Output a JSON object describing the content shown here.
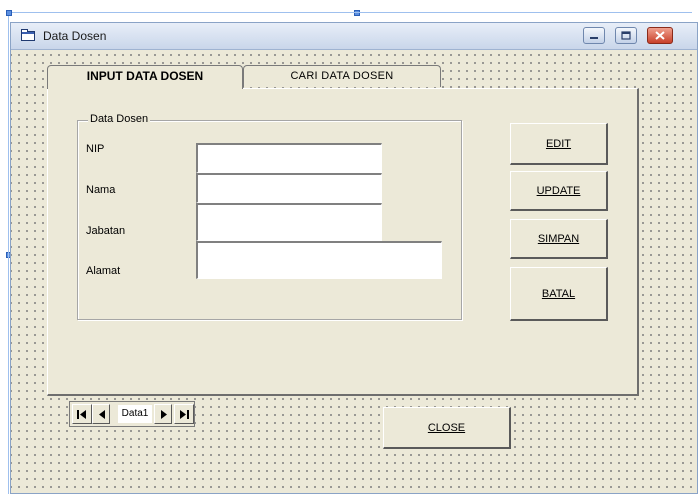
{
  "window": {
    "title": "Data Dosen"
  },
  "tabs": [
    {
      "label": "INPUT DATA DOSEN",
      "active": true
    },
    {
      "label": "CARI DATA DOSEN",
      "active": false
    }
  ],
  "frame": {
    "legend": "Data Dosen",
    "fields": [
      {
        "label": "NIP",
        "value": ""
      },
      {
        "label": "Nama",
        "value": ""
      },
      {
        "label": "Jabatan",
        "value": ""
      },
      {
        "label": "Alamat",
        "value": ""
      }
    ]
  },
  "buttons": {
    "edit": "EDIT",
    "update": "UPDATE",
    "simpan": "SIMPAN",
    "batal": "BATAL",
    "close": "CLOSE"
  },
  "data_control": {
    "caption": "Data1",
    "icons": [
      "first-record-icon",
      "previous-record-icon",
      "next-record-icon",
      "last-record-icon"
    ]
  },
  "colors": {
    "form_bg": "#ece9d8",
    "titlebar": "#c9d6ea",
    "selection": "#5b8fe0"
  }
}
